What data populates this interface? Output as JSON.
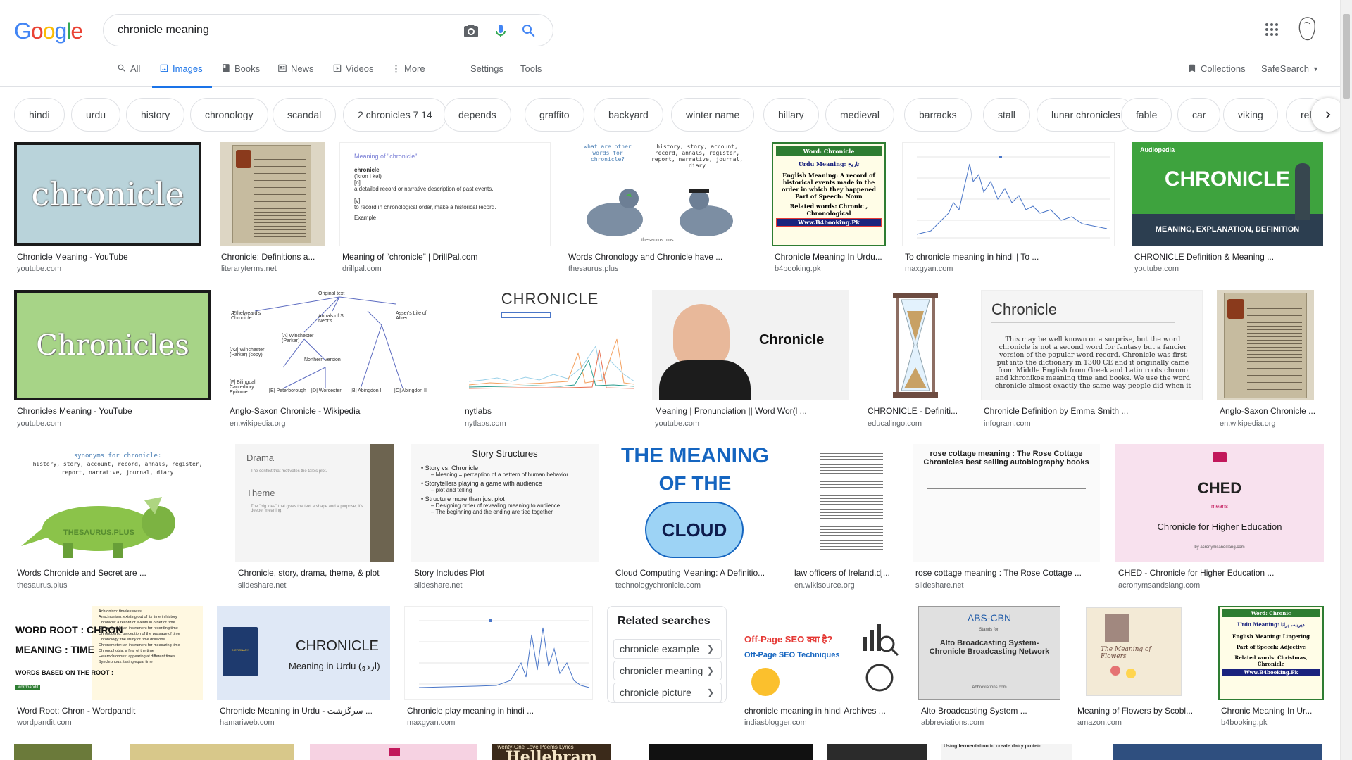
{
  "search": {
    "query": "chronicle meaning"
  },
  "logo": [
    "G",
    "o",
    "o",
    "g",
    "l",
    "e"
  ],
  "nav": {
    "all": "All",
    "images": "Images",
    "books": "Books",
    "news": "News",
    "videos": "Videos",
    "more": "More",
    "settings": "Settings",
    "tools": "Tools",
    "collections": "Collections",
    "safesearch": "SafeSearch"
  },
  "chips": [
    "hindi",
    "urdu",
    "history",
    "chronology",
    "scandal",
    "2 chronicles 7 14",
    "depends",
    "graffito",
    "backyard",
    "winter name",
    "hillary",
    "medieval",
    "barracks",
    "stall",
    "lunar chronicles",
    "fable",
    "car",
    "viking",
    "rel"
  ],
  "results": {
    "r1": [
      {
        "caption": "Chronicle Meaning - YouTube",
        "domain": "youtube.com",
        "text": "chronicle"
      },
      {
        "caption": "Chronicle: Definitions a...",
        "domain": "literaryterms.net"
      },
      {
        "caption": "Meaning of “chronicle” | DrillPal.com",
        "domain": "drillpal.com",
        "title": "Meaning of \"chronicle\"",
        "w1": "chronicle",
        "w2": "('kron i kəl)",
        "w3": "[n]",
        "w4": "a detailed record or narrative description of past events.",
        "w5": "[v]",
        "w6": "to record in chronological order, make a historical record.",
        "w7": "Example"
      },
      {
        "caption": "Words Chronology and Chronicle have ...",
        "domain": "thesaurus.plus",
        "left": "what are other words for chronicle?",
        "right": "history, story, account, record, annals, register, report, narrative, journal, diary",
        "brand": "thesaurus.plus"
      },
      {
        "caption": "Chronicle Meaning In Urdu...",
        "domain": "b4booking.pk",
        "l1": "Word: Chronicle",
        "l2": "Urdu Meaning: تاریخ",
        "l3": "English Meaning: A record of historical events made in the order in which they happened",
        "l4": "Part of Speech: Noun",
        "l5": "Related words: Chronic , Chronological",
        "l6": "Www.B4booking.Pk"
      },
      {
        "caption": "To chronicle meaning in hindi | To ...",
        "domain": "maxgyan.com"
      },
      {
        "caption": "CHRONICLE Definition & Meaning ...",
        "domain": "youtube.com",
        "t1": "CHRONICLE",
        "t2": "MEANING, EXPLANATION, DEFINITION",
        "brand": "Audiopedia"
      }
    ],
    "r2": [
      {
        "caption": "Chronicles Meaning - YouTube",
        "domain": "youtube.com",
        "text": "Chronicles"
      },
      {
        "caption": "Anglo-Saxon Chronicle - Wikipedia",
        "domain": "en.wikipedia.org",
        "n1": "Original text",
        "n2": "Æthelweard's Chronicle",
        "n3": "Annals of St. Neot's",
        "n4": "Asser's Life of Alfred",
        "n5": "[A] Winchester (Parker)",
        "n6": "[A2] Winchester (Parker) (copy)",
        "n7": "Northern version",
        "n8": "[F] Bilingual Canterbury Epitome",
        "n9": "[E] Peterborough",
        "n10": "[D] Worcester",
        "n11": "[B] Abingdon I",
        "n12": "[C] Abingdon II"
      },
      {
        "caption": "nytlabs",
        "domain": "nytlabs.com",
        "text": "CHRONICLE"
      },
      {
        "caption": "Meaning | Pronunciation || Word Wor(l ...",
        "domain": "youtube.com",
        "text": "Chronicle"
      },
      {
        "caption": "CHRONICLE - Definiti...",
        "domain": "educalingo.com"
      },
      {
        "caption": "Chronicle Definition by Emma Smith ...",
        "domain": "infogram.com",
        "title": "Chronicle",
        "body": "This may be well known or a surprise, but the word chronicle is not a second word for fantasy but a fancier version of the popular word record. Chronicle was first put into the dictionary in 1300 CE and it originally came from Middle English from Greek and Latin roots chrono and khronikos meaning time and books. We use the word chronicle almost exactly the same way people did when it"
      },
      {
        "caption": "Anglo-Saxon Chronicle ...",
        "domain": "en.wikipedia.org"
      }
    ],
    "r3": [
      {
        "caption": "Words Chronicle and Secret are ...",
        "domain": "thesaurus.plus",
        "t1": "synonyms for chronicle:",
        "t2": "history, story, account, record, annals, register,",
        "t3": "report, narrative, journal, diary",
        "brand": "THESAURUS.PLUS"
      },
      {
        "caption": "Chronicle, story, drama, theme, & plot",
        "domain": "slideshare.net",
        "h1": "Drama",
        "p1": "The conflict that motivates the tale's plot.",
        "h2": "Theme",
        "p2": "The \"big idea\" that gives the text a shape and a purpose; it's deeper meaning."
      },
      {
        "caption": "Story Includes Plot",
        "domain": "slideshare.net",
        "title": "Story Structures",
        "b1": "Story vs. Chronicle",
        "s1": "Meaning = perception of a pattern of human behavior",
        "b2": "Storytellers playing a game with audience",
        "s2": "plot and telling",
        "b3": "Structure more than just plot",
        "s3": "Designing order of revealing meaning to audience",
        "s4": "The beginning and the ending are tied together"
      },
      {
        "caption": "Cloud Computing Meaning: A Definitio...",
        "domain": "technologychronicle.com",
        "t1": "THE MEANING",
        "t2": "OF THE",
        "t3": "CLOUD"
      },
      {
        "caption": "law officers of Ireland.dj...",
        "domain": "en.wikisource.org"
      },
      {
        "caption": "rose cottage meaning : The Rose Cottage ...",
        "domain": "slideshare.net",
        "title": "rose cottage meaning : The Rose Cottage Chronicles best selling autobiography books"
      },
      {
        "caption": "CHED - Chronicle for Higher Education ...",
        "domain": "acronymsandslang.com",
        "t1": "CHED",
        "t2": "means",
        "t3": "Chronicle for Higher Education",
        "t4": "by acronymsandslang.com"
      }
    ],
    "r4": [
      {
        "caption": "Word Root: Chron - Wordpandit",
        "domain": "wordpandit.com",
        "t1": "WORD ROOT : CHRON",
        "t2": "MEANING : TIME",
        "t3": "WORDS BASED ON THE ROOT :",
        "l1": "Achronism: timelessness",
        "l2": "Anachronism: existing out of its time in history",
        "l3": "Chronicle: a record of events in order of time",
        "l4": "Chronograph: an instrument for recording time",
        "l5": "Chronogenic: perception of the passage of time",
        "l6": "Chronology: the study of time divisions",
        "l7": "Chronometer: an instrument for measuring time",
        "l8": "Chronophobia: a fear of the time",
        "l9": "Heterochronous: appearing at different times",
        "l10": "Synchronous: taking equal time",
        "brand": "wordpandit"
      },
      {
        "caption": "Chronicle Meaning in Urdu - سرگزشت ...",
        "domain": "hamariweb.com",
        "t1": "CHRONICLE",
        "t2": "Meaning in Urdu (اردو)",
        "book": "DICTIONARY"
      },
      {
        "caption": "Chronicle play meaning in hindi ...",
        "domain": "maxgyan.com"
      },
      {
        "caption": "chronicle meaning in hindi Archives ...",
        "domain": "indiasblogger.com",
        "t1": "Off-Page SEO क्या है?",
        "t2": "Off-Page SEO Techniques"
      },
      {
        "caption": "Alto Broadcasting System ...",
        "domain": "abbreviations.com",
        "t1": "ABS-CBN",
        "t2": "Stands for:",
        "t3": "Alto Broadcasting System-Chronicle Broadcasting Network",
        "t4": "Abbreviations.com"
      },
      {
        "caption": "Meaning of Flowers by Scobl...",
        "domain": "amazon.com",
        "t1": "The Meaning of Flowers"
      },
      {
        "caption": "Chronic Meaning In Ur...",
        "domain": "b4booking.pk",
        "l1": "Word: Chronic",
        "l2": "Urdu Meaning: دیرینہ، پرانا",
        "l3": "English Meaning: Lingering",
        "l4": "Part of Speech: Adjective",
        "l5": "Related words: Christmas, Chronicle",
        "l6": "Www.B4booking.Pk"
      }
    ],
    "r5": [
      {
        "t1": "Twenty-One Love Poems Lyrics",
        "t2": "Hellebram"
      },
      {
        "t1": "Using fermentation to create dairy protein"
      }
    ]
  },
  "related": {
    "title": "Related searches",
    "items": [
      "chronicle example",
      "chronicler meaning",
      "chronicle picture"
    ]
  },
  "colors": {
    "accent": "#1a73e8",
    "border": "#dfe1e5",
    "muted": "#5f6368"
  }
}
